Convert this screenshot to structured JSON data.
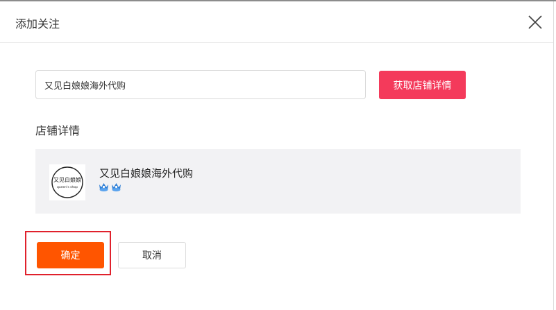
{
  "dialog": {
    "title": "添加关注",
    "close_icon": "close-icon"
  },
  "search": {
    "value": "又见白娘娘海外代购",
    "fetch_label": "获取店铺详情"
  },
  "details": {
    "section_title": "店铺详情",
    "store_name": "又见白娘娘海外代购",
    "logo_text": "又见白娘娘",
    "logo_subtext": "queen's shop",
    "badge_icon": "crown-badge-icon",
    "badge_count": 2,
    "badge_color": "#2f7fd6"
  },
  "actions": {
    "confirm_label": "确定",
    "cancel_label": "取消",
    "confirm_color": "#ff5500",
    "fetch_color": "#f43a5b",
    "highlight_color": "#e0212c"
  }
}
